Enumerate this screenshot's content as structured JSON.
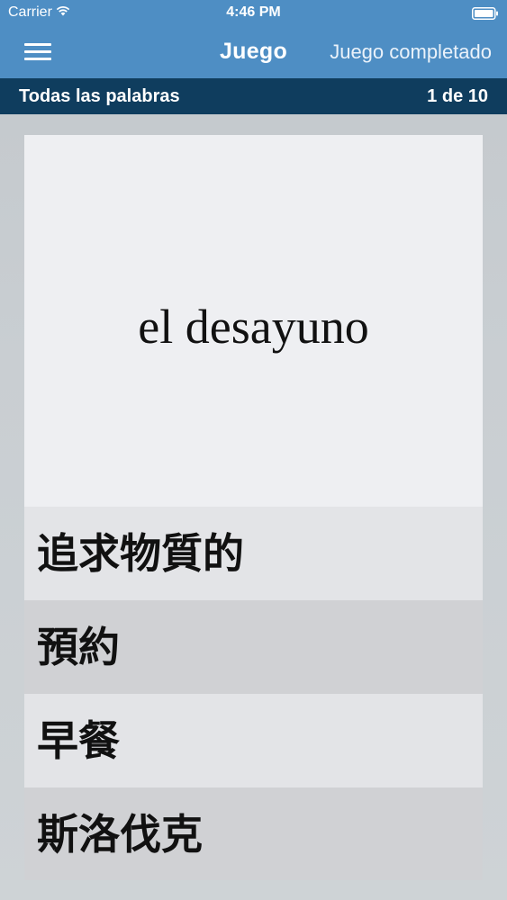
{
  "status_bar": {
    "carrier": "Carrier",
    "time": "4:46 PM",
    "icons": [
      "wifi-icon",
      "battery-icon"
    ]
  },
  "nav": {
    "menu_icon": "hamburger-menu-icon",
    "title": "Juego",
    "right_action": "Juego completado"
  },
  "sub_header": {
    "category": "Todas las palabras",
    "progress": "1 de 10"
  },
  "quiz": {
    "word": "el desayuno",
    "answers": [
      "追求物質的",
      "預約",
      "早餐",
      "斯洛伐克"
    ]
  },
  "colors": {
    "nav_bar": "#4e8ec4",
    "sub_bar": "#0f3d5e",
    "card_word_bg": "#eeeff2",
    "answer_light": "#e3e4e7",
    "answer_dark": "#d0d1d4"
  }
}
